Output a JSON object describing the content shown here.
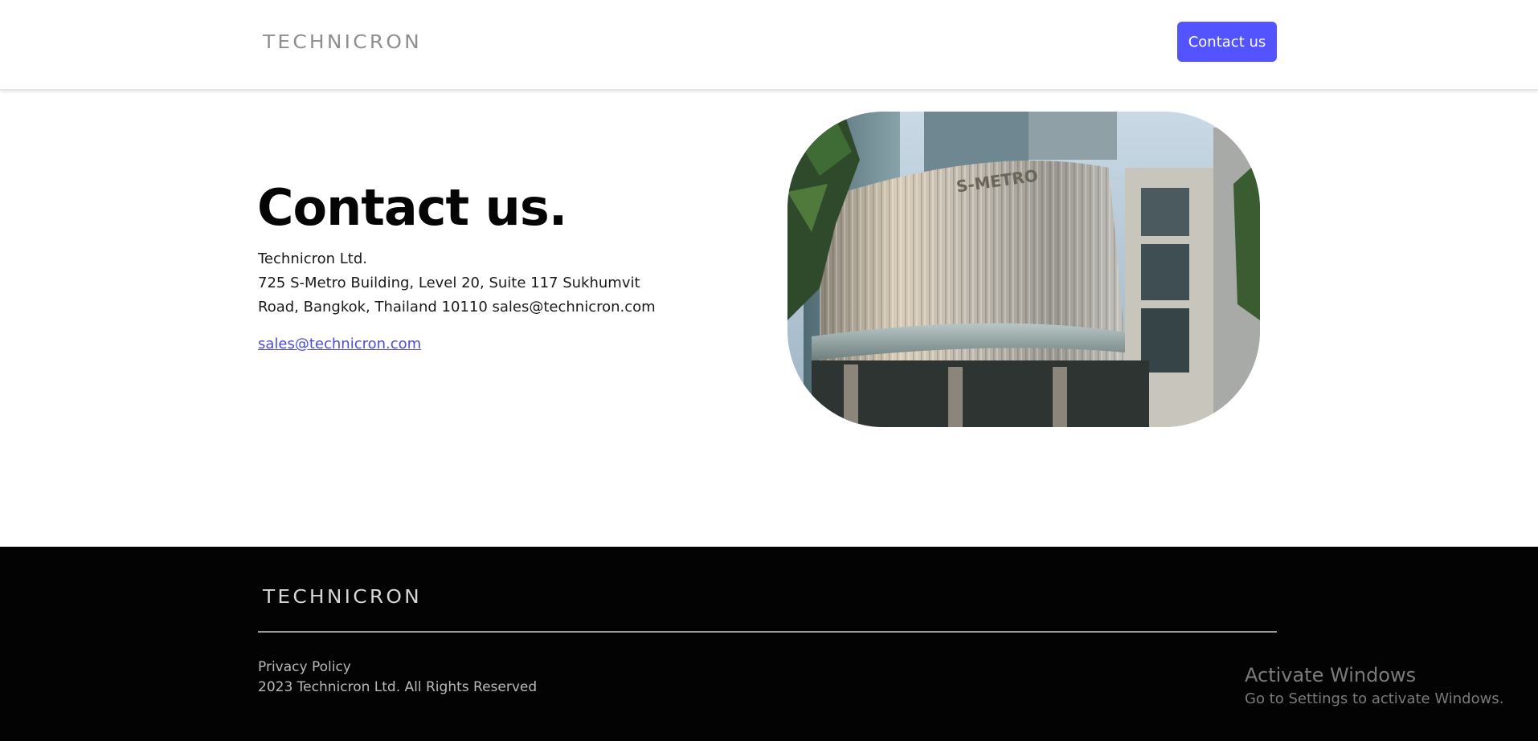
{
  "header": {
    "logo_text": "TECHNICRON",
    "contact_button_label": "Contact us"
  },
  "main": {
    "title": "Contact us.",
    "address_lines": [
      "Technicron Ltd.",
      "725 S-Metro Building, Level 20, Suite 117 Sukhumvit",
      "Road, Bangkok, Thailand 10110 sales@technicron.com"
    ],
    "email_link": "sales@technicron.com",
    "photo_sign_text": "S-METRO"
  },
  "footer": {
    "logo_text": "TECHNICRON",
    "privacy_link": "Privacy Policy",
    "copyright": "2023 Technicron Ltd. All Rights Reserved"
  },
  "watermark": {
    "title": "Activate Windows",
    "subtitle": "Go to Settings to activate Windows."
  },
  "colors": {
    "accent": "#5353ff",
    "link": "#4b4bdc",
    "footer_bg": "#030303"
  }
}
